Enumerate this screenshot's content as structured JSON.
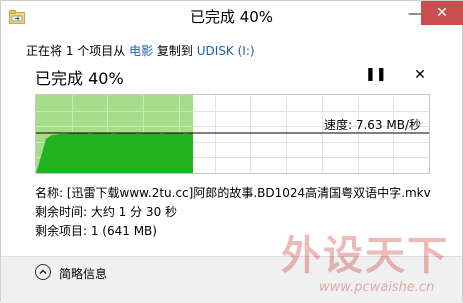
{
  "window": {
    "title": "已完成 40%",
    "minimize_glyph": "—",
    "close_glyph": "✕",
    "icon": "folder-copy-icon"
  },
  "copy_status": {
    "prefix": "正在将 1 个项目从 ",
    "source": "电影",
    "middle": " 复制到 ",
    "destination": "UDISK (I:)"
  },
  "progress": {
    "title": "已完成 40%",
    "percent": 40,
    "pause_glyph": "❚❚",
    "cancel_glyph": "✕",
    "speed_text": "速度: 7.63 MB/秒",
    "bar_color": "#a6dc8a",
    "fill_color": "#1fb320"
  },
  "file": {
    "name_text": "名称: [迅雷下载www.2tu.cc]阿郎的故事.BD1024高清国粤双语中字.mkv",
    "time_text": "剩余时间: 大约 1 分 30 秒",
    "items_text": "剩余项目: 1 (641 MB)"
  },
  "footer": {
    "details_label": "简略信息"
  },
  "watermark": {
    "title": "外设天下",
    "url": "www.pcwaishe.cn"
  }
}
